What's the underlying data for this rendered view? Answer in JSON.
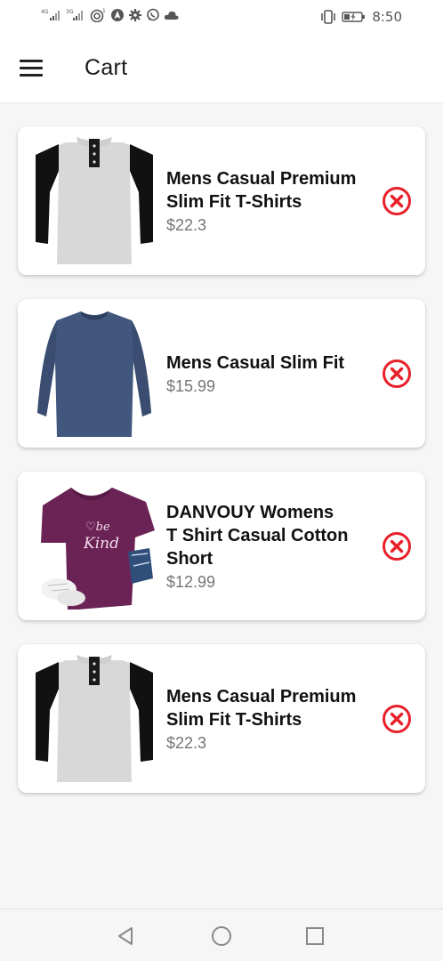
{
  "status_bar": {
    "time": "8:50",
    "icons": [
      "signal-1-icon",
      "signal-2-icon",
      "hotspot-icon",
      "navigation-app-icon",
      "settings-icon",
      "whatsapp-icon",
      "cloud-icon",
      "vibrate-icon",
      "battery-charging-icon"
    ]
  },
  "header": {
    "menu_icon": "hamburger-menu-icon",
    "title": "Cart"
  },
  "cart": {
    "items": [
      {
        "title": "Mens Casual Premium\nSlim Fit T-Shirts",
        "price": "$22.3",
        "image": "raglan-henley-gray-black"
      },
      {
        "title": "Mens Casual Slim Fit",
        "price": "$15.99",
        "image": "long-sleeve-navy-shirt"
      },
      {
        "title": "DANVOUY Womens\nT Shirt Casual Cotton\nShort",
        "price": "$12.99",
        "image": "purple-be-kind-tshirt"
      },
      {
        "title": "Mens Casual Premium\nSlim Fit T-Shirts",
        "price": "$22.3",
        "image": "raglan-henley-gray-black"
      }
    ],
    "remove_icon": "remove-circle-x-icon"
  },
  "colors": {
    "remove": "#e8202a",
    "background": "#f6f6f6",
    "card": "#ffffff"
  },
  "nav_bar": {
    "icons": [
      "back-triangle-icon",
      "home-circle-icon",
      "recents-square-icon"
    ]
  }
}
